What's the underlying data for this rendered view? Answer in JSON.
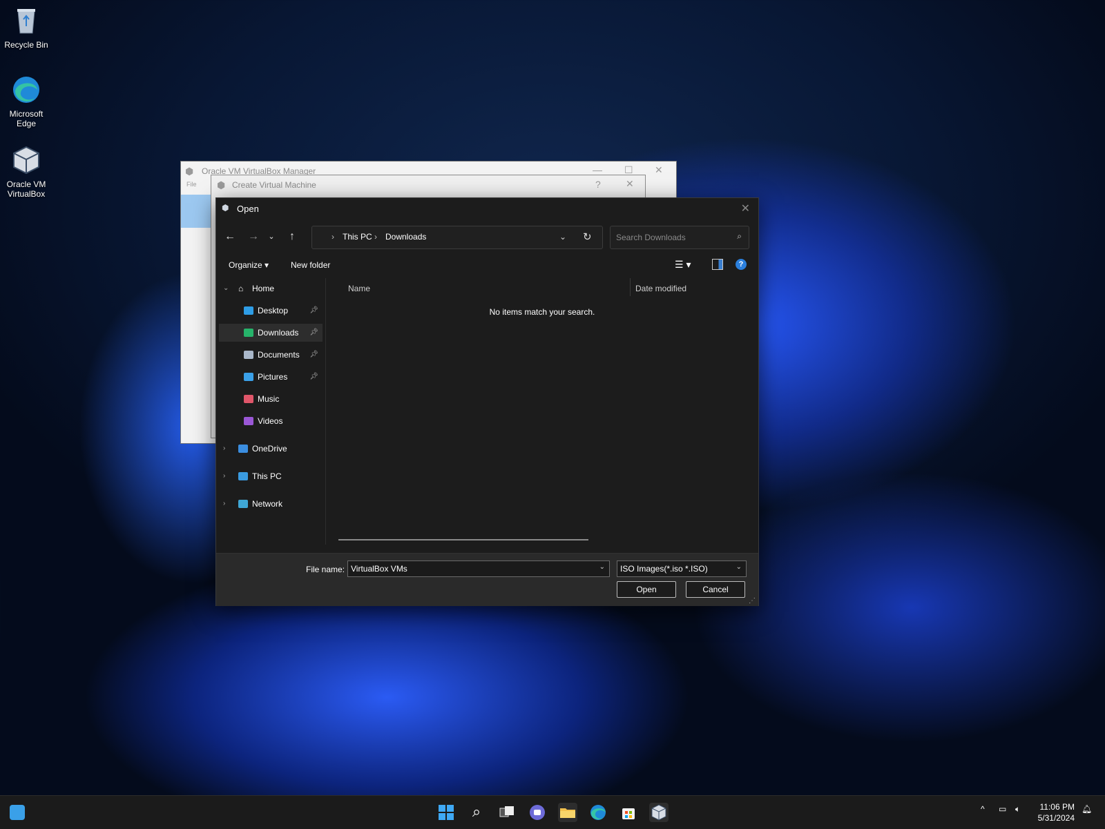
{
  "desktop": {
    "icons": [
      {
        "label_line1": "Recycle Bin",
        "label_line2": ""
      },
      {
        "label_line1": "Microsoft",
        "label_line2": "Edge"
      },
      {
        "label_line1": "Oracle VM",
        "label_line2": "VirtualBox"
      }
    ]
  },
  "vbox_manager": {
    "title": "Oracle VM VirtualBox Manager",
    "menu_first": "File"
  },
  "create_vm": {
    "title": "Create Virtual Machine",
    "help": "?"
  },
  "open_dialog": {
    "title": "Open",
    "breadcrumb": [
      "This PC",
      "Downloads"
    ],
    "search_placeholder": "Search Downloads",
    "organize_label": "Organize",
    "new_folder_label": "New folder",
    "sidebar": {
      "home": "Home",
      "quick_access": [
        {
          "label": "Desktop",
          "icon": "desktop-icon",
          "color": "#2e9de6",
          "pinned": true
        },
        {
          "label": "Downloads",
          "icon": "download-icon",
          "color": "#26b36a",
          "pinned": true
        },
        {
          "label": "Documents",
          "icon": "documents-icon",
          "color": "#a9b7c9",
          "pinned": true
        },
        {
          "label": "Pictures",
          "icon": "pictures-icon",
          "color": "#3aa0e8",
          "pinned": true
        },
        {
          "label": "Music",
          "icon": "music-icon",
          "color": "#e0566a",
          "pinned": false
        },
        {
          "label": "Videos",
          "icon": "videos-icon",
          "color": "#9a57d6",
          "pinned": false
        }
      ],
      "roots": [
        {
          "label": "OneDrive",
          "icon": "onedrive-icon",
          "color": "#3b8ee0"
        },
        {
          "label": "This PC",
          "icon": "computer-icon",
          "color": "#3a9be0"
        },
        {
          "label": "Network",
          "icon": "network-icon",
          "color": "#3fa7d6"
        }
      ]
    },
    "columns": {
      "name": "Name",
      "date_modified": "Date modified"
    },
    "empty_message": "No items match your search.",
    "file_name_label": "File name:",
    "file_name_value": "VirtualBox VMs",
    "file_type_value": "ISO Images(*.iso *.ISO)",
    "open_button": "Open",
    "cancel_button": "Cancel"
  },
  "taskbar": {
    "time": "11:06 PM",
    "date": "5/31/2024",
    "apps": [
      "start-icon",
      "search-icon",
      "task-view-icon",
      "teams-chat-icon",
      "file-explorer-icon",
      "edge-icon",
      "store-icon",
      "virtualbox-icon"
    ]
  }
}
